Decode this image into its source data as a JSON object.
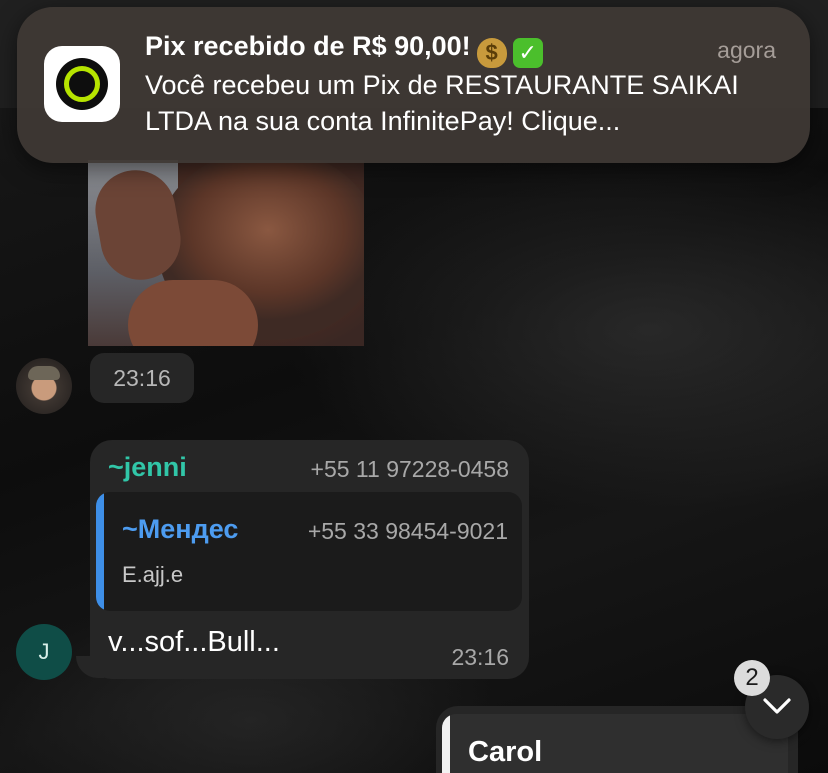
{
  "notification": {
    "app_icon": "infinitepay-ring-icon",
    "title": "Pix recebido de R$ 90,00!",
    "emoji_bag": "money-bag-icon",
    "emoji_check": "check-mark-icon",
    "time": "agora",
    "body": "Você recebeu um Pix de RESTAURANTE SAIKAI LTDA na sua conta InfinitePay! Clique..."
  },
  "image_message": {
    "time": "23:16"
  },
  "text_message": {
    "sender_name": "~jenni",
    "sender_phone": "+55 11 97228-0458",
    "quoted": {
      "name": "~Мендес",
      "phone": "+55 33 98454-9021",
      "text": "E.ajj.e"
    },
    "text": "v...sof...Bull...",
    "time": "23:16",
    "avatar_initial": "J"
  },
  "next_message": {
    "quoted_name": "Carol"
  },
  "scroll_button": {
    "unread_count": "2",
    "icon": "chevron-down-icon"
  },
  "colors": {
    "sender_name": "#31c6a8",
    "quote_name": "#4d9cf0",
    "quote_bar": "#3e8fe8",
    "bubble": "#262626",
    "notification_bg": "#3e3834",
    "accent_lime": "#b6e400"
  }
}
